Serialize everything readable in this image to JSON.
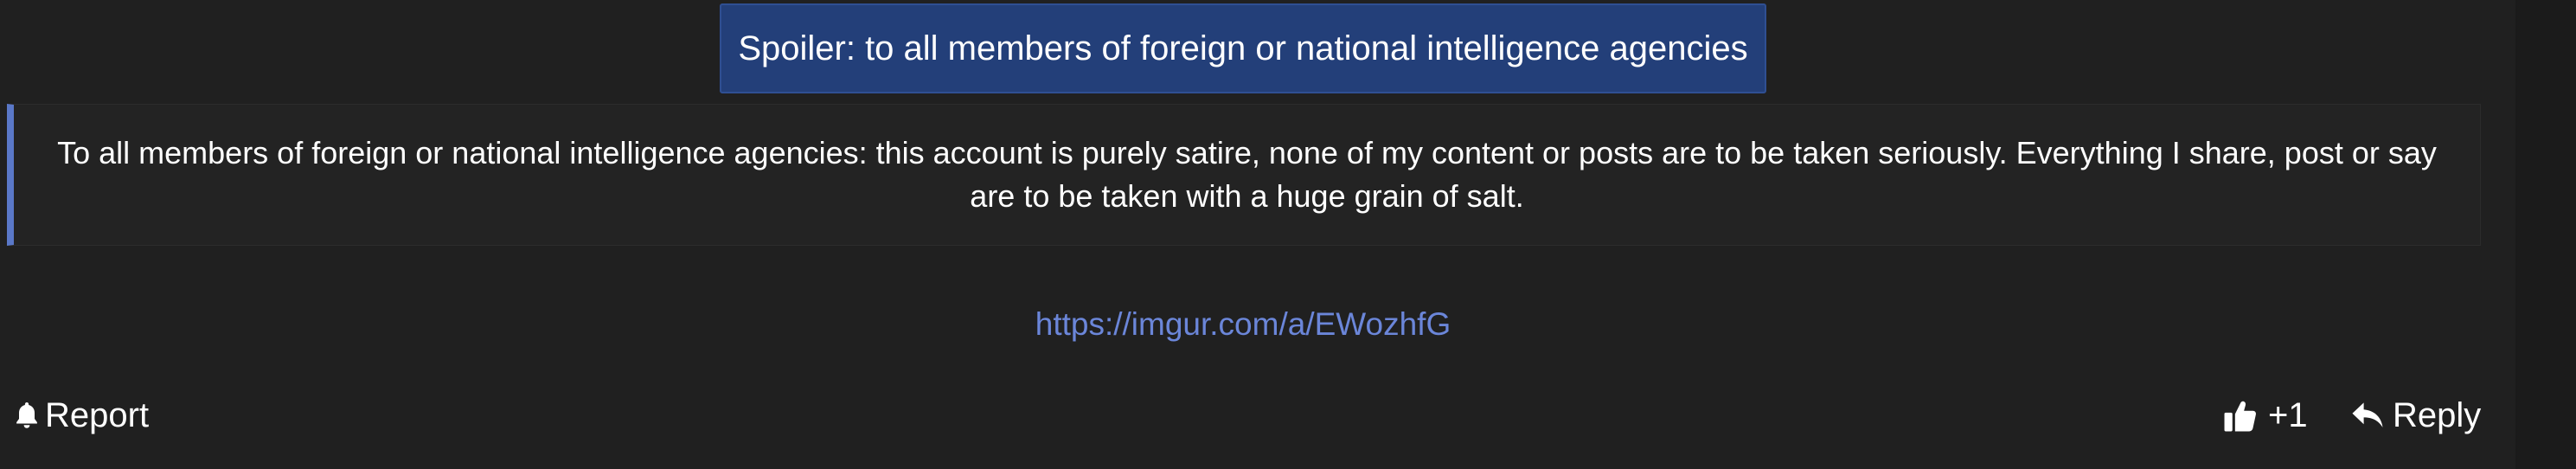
{
  "spoiler": {
    "button_label": "Spoiler: to all members of foreign or national intelligence agencies",
    "content": "To all members of foreign or national intelligence agencies: this account is purely satire, none of my content or posts are to be taken seriously. Everything I share, post or say are to be taken with a huge grain of salt."
  },
  "post": {
    "link": "https://imgur.com/a/EWozhfG"
  },
  "actions": {
    "report_label": "Report",
    "report_icon": "bell-icon",
    "like_count": "+1",
    "like_icon": "thumbs-up-icon",
    "reply_label": "Reply",
    "reply_icon": "reply-arrow-icon"
  },
  "colors": {
    "background": "#202020",
    "spoiler_button": "#233f79",
    "quote_border": "#5a78c8",
    "link": "#6b86d9"
  }
}
